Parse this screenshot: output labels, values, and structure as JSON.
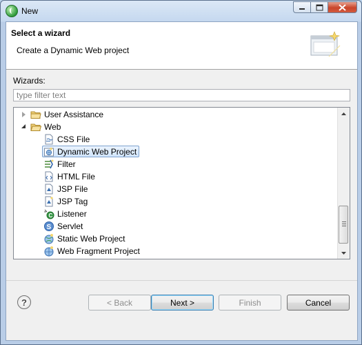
{
  "window": {
    "title": "New"
  },
  "banner": {
    "title": "Select a wizard",
    "subtitle": "Create a Dynamic Web project"
  },
  "wizards_label": "Wizards:",
  "filter": {
    "placeholder": "type filter text",
    "value": ""
  },
  "tree": {
    "items": [
      {
        "label": "User Assistance",
        "type": "folder",
        "expanded": false,
        "selected": false
      },
      {
        "label": "Web",
        "type": "folder",
        "expanded": true,
        "selected": false
      },
      {
        "label": "CSS File",
        "type": "wizard",
        "icon": "css-file-icon",
        "selected": false
      },
      {
        "label": "Dynamic Web Project",
        "type": "wizard",
        "icon": "dynamic-web-project-icon",
        "selected": true
      },
      {
        "label": "Filter",
        "type": "wizard",
        "icon": "filter-icon",
        "selected": false
      },
      {
        "label": "HTML File",
        "type": "wizard",
        "icon": "html-file-icon",
        "selected": false
      },
      {
        "label": "JSP File",
        "type": "wizard",
        "icon": "jsp-file-icon",
        "selected": false
      },
      {
        "label": "JSP Tag",
        "type": "wizard",
        "icon": "jsp-tag-icon",
        "selected": false
      },
      {
        "label": "Listener",
        "type": "wizard",
        "icon": "listener-icon",
        "selected": false
      },
      {
        "label": "Servlet",
        "type": "wizard",
        "icon": "servlet-icon",
        "selected": false
      },
      {
        "label": "Static Web Project",
        "type": "wizard",
        "icon": "static-web-project-icon",
        "selected": false
      },
      {
        "label": "Web Fragment Project",
        "type": "wizard",
        "icon": "web-fragment-project-icon",
        "selected": false
      }
    ]
  },
  "buttons": {
    "back": "< Back",
    "next": "Next >",
    "finish": "Finish",
    "cancel": "Cancel",
    "help": "?"
  },
  "colors": {
    "selection_border": "#7da2ce",
    "selection_fill": "#d1e5fc",
    "folder": "#e8c15a",
    "titlebar": "#c5d8ef",
    "close_button": "#c9452a"
  }
}
